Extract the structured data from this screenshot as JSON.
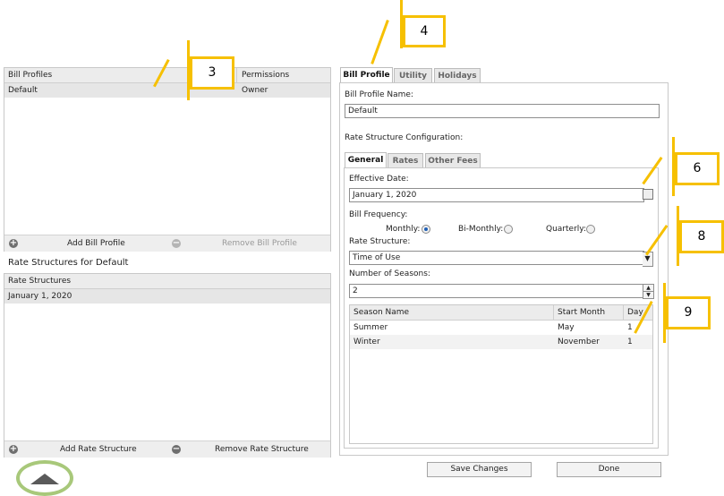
{
  "bill_profiles": {
    "col_name": "Bill Profiles",
    "col_permissions": "Permissions",
    "rows": [
      {
        "name": "Default",
        "permission": "Owner"
      }
    ],
    "add_label": "Add Bill Profile",
    "remove_label": "Remove Bill Profile"
  },
  "rate_structures": {
    "section_title": "Rate Structures for Default",
    "col_name": "Rate Structures",
    "rows": [
      "January 1, 2020"
    ],
    "add_label": "Add Rate Structure",
    "remove_label": "Remove Rate Structure"
  },
  "tabs": [
    "Bill Profile",
    "Utility",
    "Holidays"
  ],
  "profile": {
    "name_label": "Bill Profile Name:",
    "name_value": "Default",
    "config_label": "Rate Structure Configuration:"
  },
  "subtabs": [
    "General",
    "Rates",
    "Other Fees"
  ],
  "general": {
    "effective_date_label": "Effective Date:",
    "effective_date_value": "January 1, 2020",
    "bill_frequency_label": "Bill Frequency:",
    "freq_options": [
      "Monthly:",
      "Bi-Monthly:",
      "Quarterly:"
    ],
    "freq_selected": "Monthly:",
    "rate_structure_label": "Rate Structure:",
    "rate_structure_value": "Time of Use",
    "num_seasons_label": "Number of Seasons:",
    "num_seasons_value": "2"
  },
  "seasons": {
    "col_name": "Season Name",
    "col_start_month": "Start Month",
    "col_day": "Day",
    "rows": [
      {
        "name": "Summer",
        "month": "May",
        "day": "1"
      },
      {
        "name": "Winter",
        "month": "November",
        "day": "1"
      }
    ]
  },
  "buttons": {
    "save": "Save Changes",
    "done": "Done"
  },
  "callouts": [
    "3",
    "4",
    "6",
    "8",
    "9"
  ],
  "colors": {
    "callout": "#f6c000",
    "radio_selected": "#1f5fb5",
    "header_bg": "#ececec"
  }
}
